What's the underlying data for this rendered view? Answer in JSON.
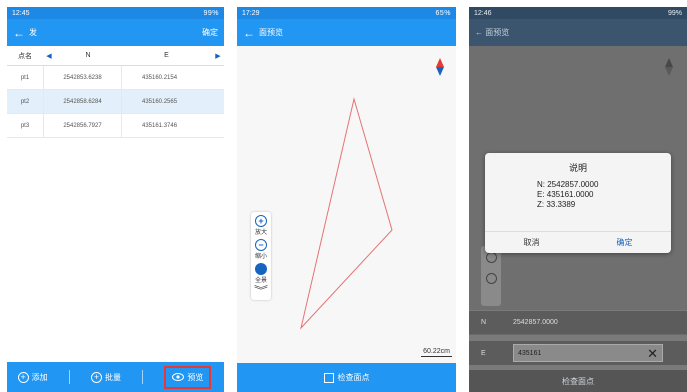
{
  "panel1": {
    "status": {
      "time": "12:45",
      "right": "99%"
    },
    "appbar": {
      "back_icon": "←",
      "title": "发",
      "action": "确定"
    },
    "table": {
      "headers": {
        "name": "点名",
        "n": "N",
        "e": "E"
      },
      "rows": [
        {
          "name": "pt1",
          "n": "2542853.6238",
          "e": "435160.2154"
        },
        {
          "name": "pt2",
          "n": "2542858.6284",
          "e": "435160.2565"
        },
        {
          "name": "pt3",
          "n": "2542856.7927",
          "e": "435161.3746"
        }
      ],
      "selected_row": 1
    },
    "bottom": {
      "add": "添加",
      "batch": "批量",
      "preview": "预览"
    }
  },
  "panel2": {
    "status": {
      "time": "17:29",
      "right": "65%"
    },
    "appbar": {
      "back_icon": "←",
      "title": "面预览"
    },
    "tools": {
      "zoom_in": "放大",
      "zoom_out": "缩小",
      "full": "全景",
      "more_icon": "chevron-double-down-icon"
    },
    "scale": "60.22cm",
    "bottom": {
      "check": "检查面点"
    },
    "colors": {
      "polygon": "#e57373"
    }
  },
  "panel3": {
    "status": {
      "time": "12:46",
      "right": "99%"
    },
    "appbar": {
      "title": "面预览"
    },
    "dialog": {
      "title": "说明",
      "lines": [
        "N: 2542857.0000",
        "E: 435161.0000",
        "Z: 33.3389"
      ],
      "cancel": "取消",
      "ok": "确定"
    },
    "form": {
      "n_label": "N",
      "n_value": "2542857.0000",
      "e_label": "E",
      "e_value": "435161"
    },
    "bottom": {
      "check": "检查面点"
    }
  },
  "colors": {
    "primary": "#2196f3",
    "highlight": "#e53935"
  }
}
